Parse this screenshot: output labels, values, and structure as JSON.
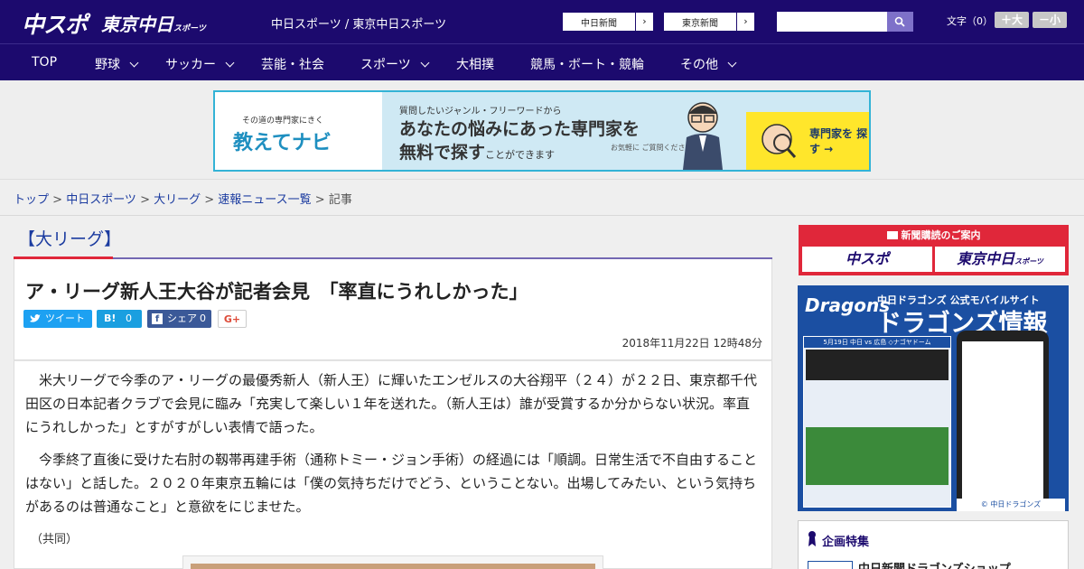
{
  "header": {
    "logo_chuspo": "中スポ",
    "logo_tokyo": "東京中日",
    "logo_tokyo_small": "スポーツ",
    "site_title": "中日スポーツ / 東京中日スポーツ",
    "btn_chunichi": "中日新聞",
    "btn_tokyo": "東京新聞",
    "search_placeholder": "",
    "fontsize_label": "文字（0）",
    "fontsize_large": "＋大",
    "fontsize_small": "－小"
  },
  "nav": [
    {
      "label": "TOP"
    },
    {
      "label": "野球"
    },
    {
      "label": "サッカー"
    },
    {
      "label": "芸能・社会"
    },
    {
      "label": "スポーツ"
    },
    {
      "label": "大相撲"
    },
    {
      "label": "競馬・ボート・競輪"
    },
    {
      "label": "その他"
    }
  ],
  "banner": {
    "sub": "その道の専門家にきく",
    "main": "教えてナビ",
    "line1": "質問したいジャンル・フリーワードから",
    "line2": "あなたの悩みにあった専門家を",
    "line3": "無料で探す",
    "line3_tail": "ことができます",
    "note": "お気軽に ご質問ください!",
    "cta": "専門家を 探す →"
  },
  "breadcrumb": {
    "top": "トップ",
    "chuspo": "中日スポーツ",
    "mlb": "大リーグ",
    "news": "速報ニュース一覧",
    "current": "記事",
    "sep": " > "
  },
  "article": {
    "category": "【大リーグ】",
    "headline": "ア・リーグ新人王大谷が記者会見　「率直にうれしかった」",
    "share_tw": "ツイート",
    "share_hb": "0",
    "share_fb_label": "シェア",
    "share_fb_count": "0",
    "share_gp": "G+",
    "date": "2018年11月22日 12時48分",
    "p1": "　米大リーグで今季のア・リーグの最優秀新人（新人王）に輝いたエンゼルスの大谷翔平（２４）が２２日、東京都千代田区の日本記者クラブで会見に臨み「充実して楽しい１年を送れた。（新人王は）誰が受賞するか分からない状況。率直にうれしかった」とすがすがしい表情で語った。",
    "p2": "　今季終了直後に受けた右肘の靱帯再建手術（通称トミー・ジョン手術）の経過には「順調。日常生活で不自由することはない」と話した。２０２０年東京五輪には「僕の気持ちだけでどう、ということない。出場してみたい、という気持ちがあるのは普通なこと」と意欲をにじませた。",
    "credit": "（共同）"
  },
  "sidebar": {
    "subscribe_title": "新聞購読のご案内",
    "sub_logo1": "中スポ",
    "sub_logo2": "東京中日",
    "sub_logo2_small": "スポーツ",
    "dragons_logo": "Dragons",
    "dragons_sub": "中日ドラゴンズ 公式モバイルサイト",
    "dragons_main": "ドラゴンズ情報",
    "dragons_score": "5月19日 中日 vs 広島 ◇ナゴヤドーム",
    "dragons_footer": "© 中日ドラゴンズ",
    "kikaku_title": "企画特集",
    "kikaku_item": "中日新聞ドラゴンズショップ"
  },
  "colors": {
    "header_bg": "#1c0a6e",
    "accent_red": "#e0273a",
    "link": "#1c3ca0"
  }
}
